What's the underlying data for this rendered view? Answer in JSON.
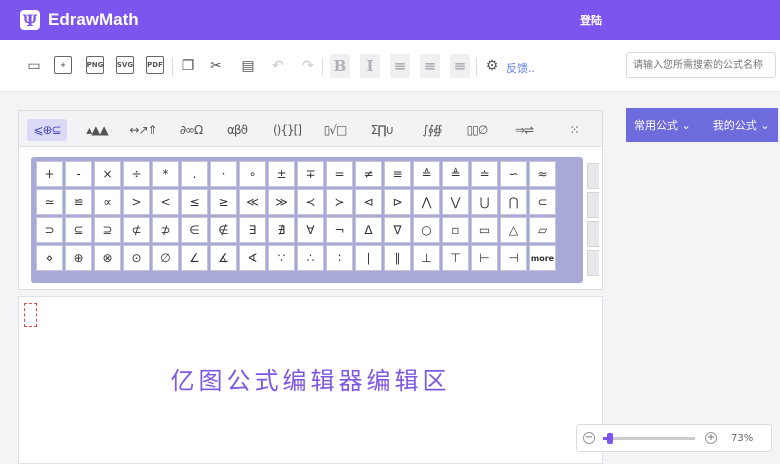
{
  "header": {
    "logo_glyph": "Ψ",
    "title": "EdrawMath",
    "login_label": "登陆",
    "color": "#7b55ee"
  },
  "toolbar": {
    "icons": [
      {
        "name": "open-folder-icon",
        "glyph": "▭",
        "style": "plain"
      },
      {
        "name": "new-file-icon",
        "glyph": "+",
        "style": "btn"
      },
      {
        "name": "export-png-icon",
        "glyph": "PNG",
        "style": "btn"
      },
      {
        "name": "export-svg-icon",
        "glyph": "SVG",
        "style": "btn"
      },
      {
        "name": "export-pdf-icon",
        "glyph": "PDF",
        "style": "btn"
      },
      {
        "name": "copy-icon",
        "glyph": "❐",
        "style": "plain"
      },
      {
        "name": "cut-icon",
        "glyph": "✂",
        "style": "plain"
      },
      {
        "name": "paste-icon",
        "glyph": "▤",
        "style": "plain"
      },
      {
        "name": "undo-icon",
        "glyph": "↶",
        "style": "disabled"
      },
      {
        "name": "redo-icon",
        "glyph": "↷",
        "style": "disabled"
      },
      {
        "name": "bold-icon",
        "glyph": "B",
        "style": "shaded"
      },
      {
        "name": "italic-icon",
        "glyph": "I",
        "style": "shaded"
      },
      {
        "name": "align-left-icon",
        "glyph": "≡",
        "style": "shaded"
      },
      {
        "name": "align-center-icon",
        "glyph": "≡",
        "style": "shaded"
      },
      {
        "name": "align-right-icon",
        "glyph": "≡",
        "style": "shaded"
      },
      {
        "name": "settings-gear-icon",
        "glyph": "⚙",
        "style": "plain"
      }
    ],
    "feedback_label": "反馈..",
    "search_placeholder": "请输入您所需搜索的公式名称"
  },
  "symbol_categories": [
    {
      "label": "⩽⊕⊆",
      "active": true
    },
    {
      "label": "▴▲▲",
      "active": false
    },
    {
      "label": "↔↗⇑",
      "active": false
    },
    {
      "label": "∂∞Ω",
      "active": false
    },
    {
      "label": "αβϑ",
      "active": false
    },
    {
      "label": "(){}[]",
      "active": false
    },
    {
      "label": "▯√□",
      "active": false
    },
    {
      "label": "Σ∏∪",
      "active": false
    },
    {
      "label": "∫∮∯",
      "active": false
    },
    {
      "label": "▯▯∅",
      "active": false
    },
    {
      "label": "⇒⇌",
      "active": false
    },
    {
      "label": "⁙",
      "active": false
    }
  ],
  "symbols": [
    "+",
    "-",
    "×",
    "÷",
    "*",
    ".",
    "·",
    "∘",
    "±",
    "∓",
    "=",
    "≠",
    "≡",
    "≙",
    "≜",
    "≐",
    "∽",
    "≈",
    "≃",
    "≌",
    "∝",
    ">",
    "<",
    "≤",
    "≥",
    "≪",
    "≫",
    "≺",
    "≻",
    "⊲",
    "⊳",
    "⋀",
    "⋁",
    "⋃",
    "⋂",
    "⊂",
    "⊃",
    "⊆",
    "⊇",
    "⊄",
    "⊅",
    "∈",
    "∉",
    "∃",
    "∄",
    "∀",
    "¬",
    "∆",
    "∇",
    "○",
    "▫",
    "▭",
    "△",
    "▱",
    "⋄",
    "⊕",
    "⊗",
    "⊙",
    "∅",
    "∠",
    "∡",
    "∢",
    "∵",
    "∴",
    "∶",
    "∣",
    "∥",
    "⊥",
    "⊤",
    "⊢",
    "⊣",
    "more"
  ],
  "editor": {
    "placeholder_text": "亿图公式编辑器编辑区"
  },
  "right_panel": {
    "tabs": [
      "常用公式",
      "我的公式"
    ]
  },
  "zoom": {
    "level_percent": 73,
    "label": "73%"
  }
}
